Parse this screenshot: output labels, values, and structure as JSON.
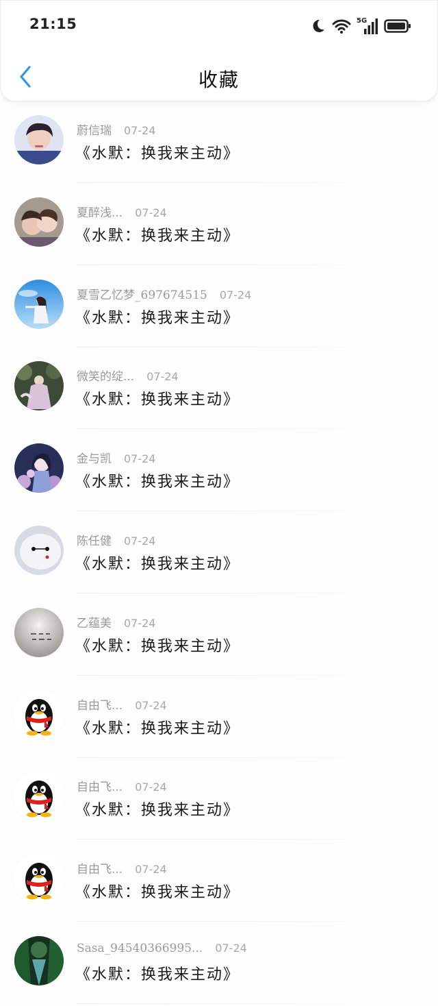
{
  "status_bar": {
    "time": "21:15",
    "network": "5G"
  },
  "nav": {
    "title": "收藏",
    "back_icon": "chevron-left-icon",
    "accent_color": "#2b9af3"
  },
  "favorites": [
    {
      "name": "蔚信瑞",
      "date": "07-24",
      "title": "《水默：换我来主动》",
      "avatar": "photo-boy"
    },
    {
      "name": "夏醉浅...",
      "date": "07-24",
      "title": "《水默：换我来主动》",
      "avatar": "photo-couple"
    },
    {
      "name": "夏雪乙忆梦_697674515",
      "date": "07-24",
      "title": "《水默：换我来主动》",
      "avatar": "photo-sky"
    },
    {
      "name": "微笑的绽...",
      "date": "07-24",
      "title": "《水默：换我来主动》",
      "avatar": "photo-garden"
    },
    {
      "name": "金与凯",
      "date": "07-24",
      "title": "《水默：换我来主动》",
      "avatar": "photo-anime"
    },
    {
      "name": "陈任健",
      "date": "07-24",
      "title": "《水默：换我来主动》",
      "avatar": "baymax"
    },
    {
      "name": "乙蕴美",
      "date": "07-24",
      "title": "《水默：换我来主动》",
      "avatar": "photo-note"
    },
    {
      "name": "自由飞...",
      "date": "07-24",
      "title": "《水默：换我来主动》",
      "avatar": "qq-penguin"
    },
    {
      "name": "自由飞...",
      "date": "07-24",
      "title": "《水默：换我来主动》",
      "avatar": "qq-penguin"
    },
    {
      "name": "自由飞...",
      "date": "07-24",
      "title": "《水默：换我来主动》",
      "avatar": "qq-penguin"
    },
    {
      "name": "Sasa_94540366995...",
      "date": "07-24",
      "title": "《水默：换我来主动》",
      "avatar": "photo-forest"
    }
  ]
}
